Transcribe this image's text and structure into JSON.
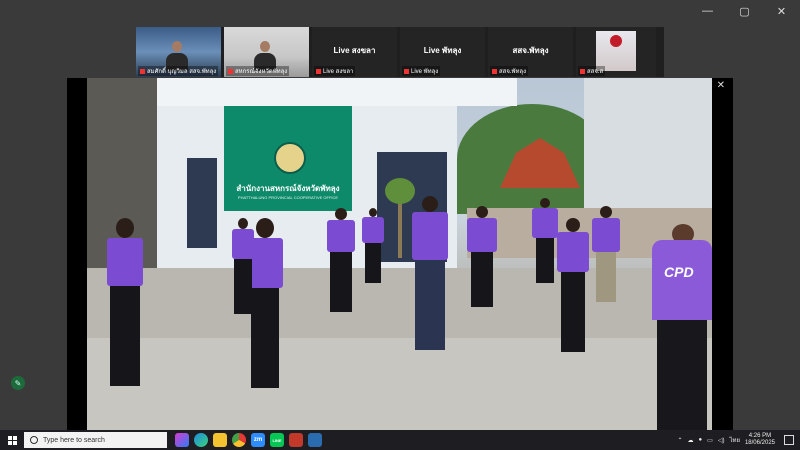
{
  "window_controls": {
    "minimize": "—",
    "maximize": "▢",
    "close": "✕"
  },
  "participants": [
    {
      "name": "สมศักดิ์ บุญวิมล สสจ.พัทลุง",
      "center_label": "",
      "kind": "video1"
    },
    {
      "name": "สหกรณ์จังหวัดพัทลุง",
      "center_label": "",
      "kind": "video2"
    },
    {
      "name": "Live สงขลา",
      "center_label": "Live สงขลา",
      "kind": "label"
    },
    {
      "name": "Live พัทลุง",
      "center_label": "Live พัทลุง",
      "kind": "label"
    },
    {
      "name": "สสจ.พัทลุง",
      "center_label": "สสจ.พัทลุง",
      "kind": "label"
    },
    {
      "name": "สสจ.ส",
      "center_label": "",
      "kind": "avatar"
    }
  ],
  "share": {
    "close_label": "✕",
    "sign_title": "สำนักงานสหกรณ์จังหวัดพัทลุง",
    "sign_subtitle": "PHATTHALUNG PROVINCIAL COOPERATIVE OFFICE",
    "shirt_text": "CPD"
  },
  "taskbar": {
    "search_placeholder": "Type here to search",
    "apps": [
      "copilot-icon",
      "edge-icon",
      "file-explorer-icon",
      "chrome-icon",
      "zoom-icon",
      "line-icon",
      "app-red-icon",
      "app-blue-icon"
    ],
    "zoom_label": "zm",
    "line_label": "LINE",
    "lang": "ไทย",
    "time": "4:26 PM",
    "date": "18/06/2025"
  },
  "colors": {
    "shirt_purple": "#7b4bd2",
    "sign_green": "#0d8a6a",
    "taskbar_bg": "#1e1e22"
  }
}
